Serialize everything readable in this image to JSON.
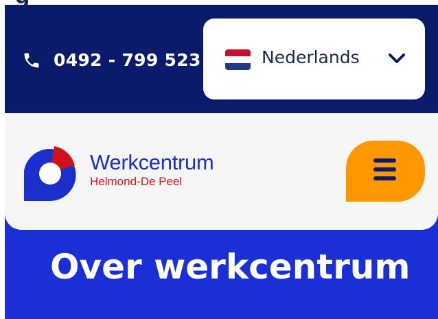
{
  "top_bar": {
    "phone": "0492 - 799 523",
    "language": {
      "selected": "Nederlands",
      "flag_colors": [
        "#c8102e",
        "#ffffff",
        "#1f3c8a"
      ]
    }
  },
  "header": {
    "logo": {
      "title": "Werkcentrum",
      "subtitle": "Helmond-De Peel"
    },
    "menu_icon": "hamburger-icon"
  },
  "hero": {
    "title": "Over werkcentrum"
  },
  "clipped_heading_fragment": "g"
}
